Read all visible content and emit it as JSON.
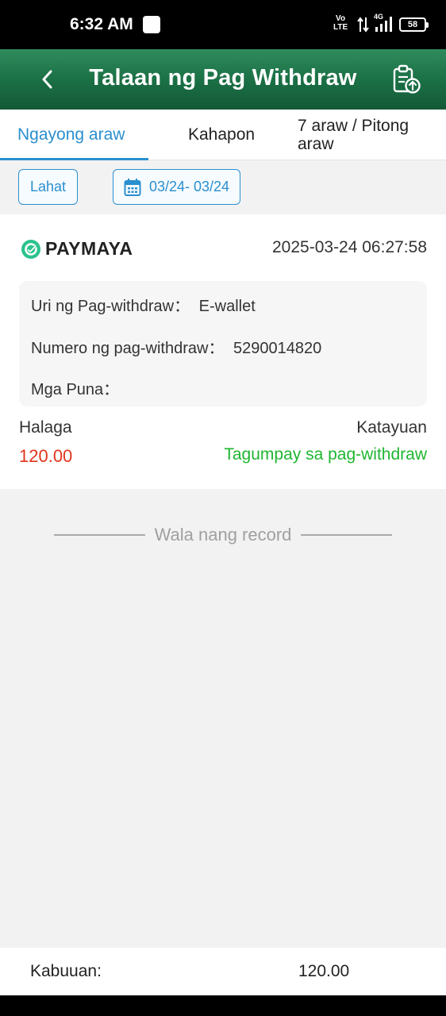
{
  "status_bar": {
    "time": "6:32 AM",
    "volte_top": "Vo",
    "volte_bottom": "LTE",
    "network": "4G",
    "battery": "58"
  },
  "header": {
    "title": "Talaan ng Pag Withdraw"
  },
  "tabs": [
    {
      "label": "Ngayong araw",
      "active": true
    },
    {
      "label": "Kahapon",
      "active": false
    },
    {
      "label": "7 araw / Pitong araw",
      "active": false
    }
  ],
  "filters": {
    "all_label": "Lahat",
    "date_range": "03/24- 03/24"
  },
  "record": {
    "provider": "PAYMAYA",
    "datetime": "2025-03-24 06:27:58",
    "type_label": "Uri ng Pag-withdraw：",
    "type_value": "E-wallet",
    "number_label": "Numero ng pag-withdraw：",
    "number_value": "5290014820",
    "remarks_label": "Mga Puna：",
    "remarks_value": "",
    "amount_label": "Halaga",
    "amount_value": "120.00",
    "status_label": "Katayuan",
    "status_value": "Tagumpay sa pag-withdraw"
  },
  "list_end": "Wala nang record",
  "footer": {
    "total_label": "Kabuuan:",
    "total_value": "120.00"
  },
  "colors": {
    "header_green": "#1a6e44",
    "accent_blue": "#2a8fce",
    "amount_red": "#e2341d",
    "status_green": "#1fb630",
    "paymaya_green": "#2bc38c"
  }
}
